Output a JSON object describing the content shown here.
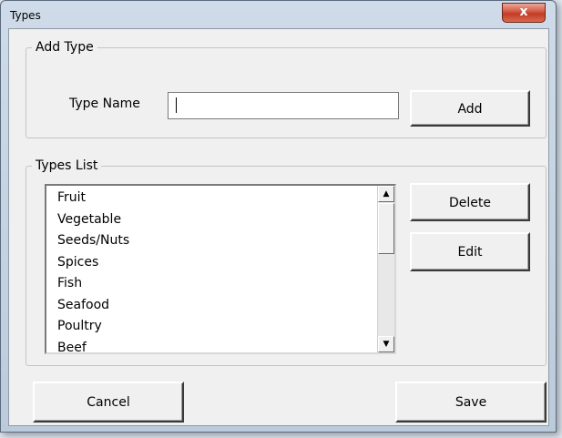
{
  "window": {
    "title": "Types",
    "close_glyph": "x"
  },
  "add_type": {
    "group_label": "Add Type",
    "type_name_label": "Type Name",
    "type_name_value": "",
    "add_button": "Add"
  },
  "types_list": {
    "group_label": "Types List",
    "items": [
      "Fruit",
      "Vegetable",
      "Seeds/Nuts",
      "Spices",
      "Fish",
      "Seafood",
      "Poultry",
      "Beef"
    ],
    "delete_button": "Delete",
    "edit_button": "Edit",
    "scroll_up_glyph": "▲",
    "scroll_down_glyph": "▼"
  },
  "footer": {
    "cancel_button": "Cancel",
    "save_button": "Save"
  },
  "colors": {
    "close_button": "#c9432c",
    "dialog_background": "#f0f0f0"
  },
  "icons": {
    "close": "close-icon",
    "scroll_up": "scroll-up-arrow-icon",
    "scroll_down": "scroll-down-arrow-icon"
  }
}
